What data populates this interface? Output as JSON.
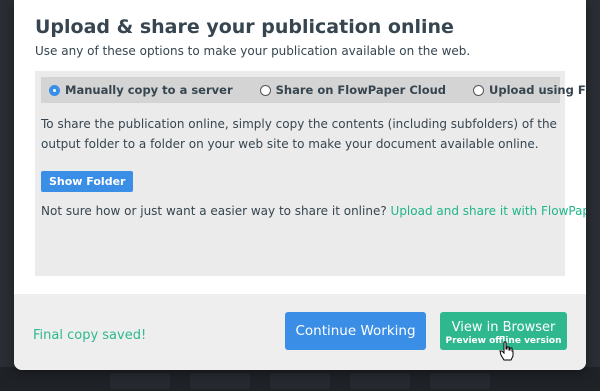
{
  "dialog": {
    "title": "Upload & share your publication online",
    "subtitle": "Use any of these options to make your publication available on the web."
  },
  "share_options": [
    {
      "label": "Manually copy to a server",
      "selected": true
    },
    {
      "label": "Share on FlowPaper Cloud",
      "selected": false
    },
    {
      "label": "Upload using FTP/SSH",
      "selected": false
    }
  ],
  "manual": {
    "description": "To share the publication online, simply copy the contents (including subfolders) of the output folder to a folder on your web site to make your document available online.",
    "show_folder_label": "Show Folder",
    "help_text": "Not sure how or just want a easier way to share it online?",
    "help_link": "Upload and share it with FlowPaper Cloud"
  },
  "footer": {
    "status": "Final copy saved!",
    "continue_label": "Continue Working",
    "view_label": "View in Browser",
    "view_sublabel": "Preview offline version"
  },
  "colors": {
    "accent_blue": "#3a8ee6",
    "accent_green": "#2fb88e",
    "text": "#36454f"
  },
  "icons": [
    "radio-selected-icon",
    "radio-icon",
    "pointer-cursor-icon"
  ]
}
